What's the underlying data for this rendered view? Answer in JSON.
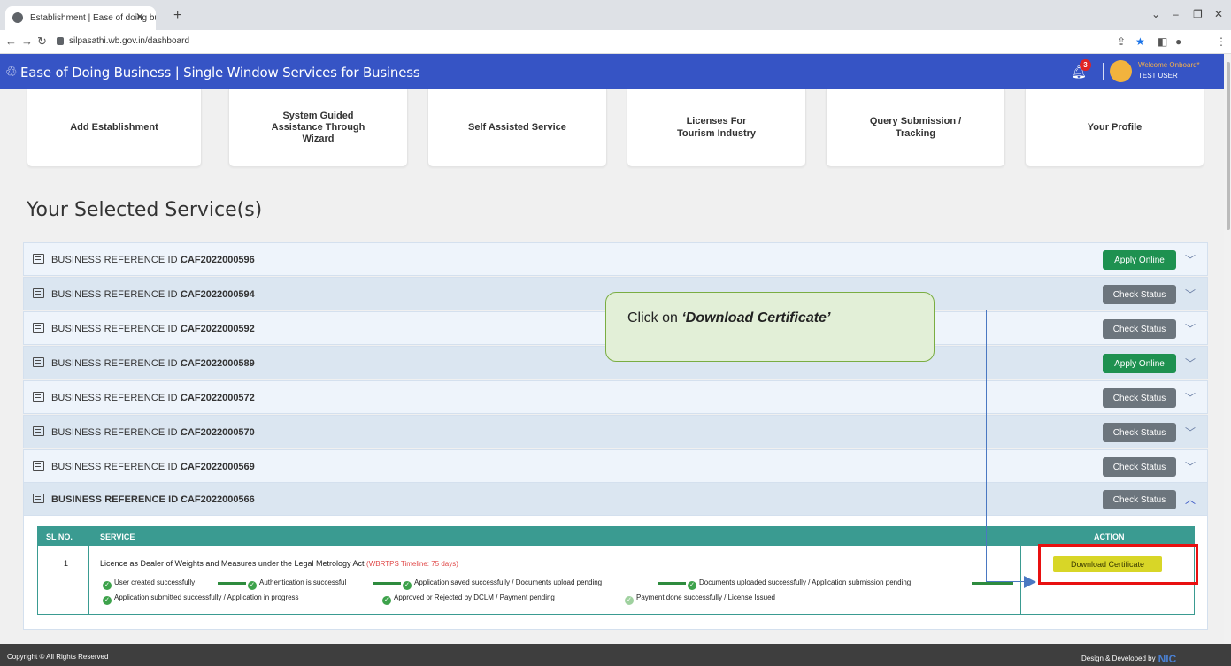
{
  "browser": {
    "tab_title": "Establishment | Ease of doing bu",
    "url": "silpasathi.wb.gov.in/dashboard"
  },
  "header": {
    "title": "Ease of Doing Business | Single Window Services for Business",
    "notification_count": "3",
    "welcome": "Welcome Onboard*",
    "user": "TEST USER",
    "accent_color": "#3654c5"
  },
  "menu_cards": [
    "Add Establishment",
    "System Guided Assistance Through Wizard",
    "Self Assisted Service",
    "Licenses For Tourism Industry",
    "Query Submission / Tracking",
    "Your Profile"
  ],
  "section_title": "Your Selected Service(s)",
  "rows": [
    {
      "label": "BUSINESS REFERENCE ID :",
      "id": "CAF2022000596",
      "button": "Apply Online",
      "button_color": "#1e9150"
    },
    {
      "label": "BUSINESS REFERENCE ID :",
      "id": "CAF2022000594",
      "button": "Check Status",
      "button_color": "#6c757d"
    },
    {
      "label": "BUSINESS REFERENCE ID :",
      "id": "CAF2022000592",
      "button": "Check Status",
      "button_color": "#6c757d"
    },
    {
      "label": "BUSINESS REFERENCE ID :",
      "id": "CAF2022000589",
      "button": "Apply Online",
      "button_color": "#1e9150"
    },
    {
      "label": "BUSINESS REFERENCE ID :",
      "id": "CAF2022000572",
      "button": "Check Status",
      "button_color": "#6c757d"
    },
    {
      "label": "BUSINESS REFERENCE ID :",
      "id": "CAF2022000570",
      "button": "Check Status",
      "button_color": "#6c757d"
    },
    {
      "label": "BUSINESS REFERENCE ID :",
      "id": "CAF2022000569",
      "button": "Check Status",
      "button_color": "#6c757d"
    },
    {
      "label": "BUSINESS REFERENCE ID :",
      "id": "CAF2022000566",
      "button": "Check Status",
      "button_color": "#6c757d"
    }
  ],
  "table": {
    "headers": {
      "sl": "SL NO.",
      "service": "SERVICE",
      "action": "ACTION"
    },
    "row": {
      "sl": "1",
      "service": "Licence as Dealer of Weights and Measures under the Legal Metrology Act",
      "timeline": "(WBRTPS Timeline: 75 days)",
      "action": "Download Certificate",
      "steps": [
        "User created successfully",
        "Authentication is successful",
        "Application saved successfully / Documents upload pending",
        "Documents uploaded successfully / Application submission pending",
        "Application submitted successfully / Application in progress",
        "Approved or Rejected by DCLM / Payment pending",
        "Payment done successfully / License Issued"
      ]
    }
  },
  "callout": {
    "prefix": "Click on ",
    "emphasis": "‘Download Certificate’"
  },
  "footer": {
    "left": "Copyright © All Rights Reserved",
    "right": "Design & Developed by",
    "logo": "NIC"
  }
}
